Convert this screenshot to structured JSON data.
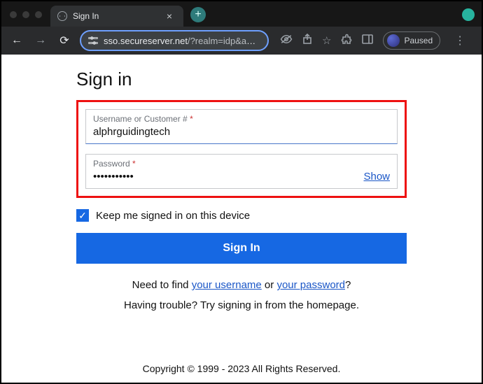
{
  "browser": {
    "tab_title": "Sign In",
    "url_host": "sso.secureserver.net",
    "url_path": "/?realm=idp&app…",
    "paused_label": "Paused"
  },
  "page": {
    "heading": "Sign in",
    "username": {
      "label": "Username or Customer #",
      "required": "*",
      "value": "alphrguidingtech"
    },
    "password": {
      "label": "Password",
      "required": "*",
      "masked_value": "•••••••••••",
      "show_label": "Show"
    },
    "remember_label": "Keep me signed in on this device",
    "submit_label": "Sign In",
    "find_prefix": "Need to find ",
    "find_username_link": "your username",
    "find_middle": " or ",
    "find_password_link": "your password",
    "find_suffix": "?",
    "trouble_text": "Having trouble? Try signing in from the homepage.",
    "copyright": "Copyright © 1999 - 2023 All Rights Reserved."
  }
}
